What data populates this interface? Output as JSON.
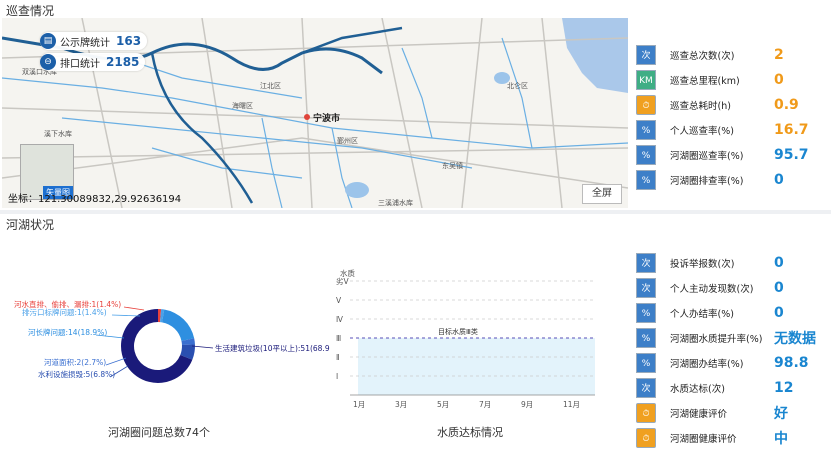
{
  "patrol": {
    "title": "巡查情况",
    "map": {
      "stat1_label": "公示牌统计",
      "stat1_value": "163",
      "stat2_label": "排口统计",
      "stat2_value": "2185",
      "city_label": "宁波市",
      "place_labels": [
        "双溪口水库",
        "溪下水库",
        "三溪浦水库",
        "海曙区",
        "江北区",
        "鄞州区",
        "北仑区",
        "东吴镇"
      ],
      "thumb_label": "矢量图",
      "coord_label": "坐标：121.30089832,29.92636194",
      "fullscreen_label": "全屏"
    },
    "stats": [
      {
        "icon": "次",
        "icon_name": "count-icon",
        "color": "blue",
        "label": "巡查总次数(次)",
        "value": "2",
        "vclass": "v-orange"
      },
      {
        "icon": "KM",
        "icon_name": "distance-icon",
        "color": "green",
        "label": "巡查总里程(km)",
        "value": "0",
        "vclass": "v-orange"
      },
      {
        "icon": "⏱",
        "icon_name": "clock-icon",
        "color": "orange",
        "label": "巡查总耗时(h)",
        "value": "0.9",
        "vclass": "v-orange"
      },
      {
        "icon": "%",
        "icon_name": "percent-icon",
        "color": "blue",
        "label": "个人巡查率(%)",
        "value": "16.7",
        "vclass": "v-orange"
      },
      {
        "icon": "%",
        "icon_name": "percent-icon",
        "color": "blue",
        "label": "河湖圈巡查率(%)",
        "value": "95.7",
        "vclass": "v-blue"
      },
      {
        "icon": "%",
        "icon_name": "percent-icon",
        "color": "blue",
        "label": "河湖圈排查率(%)",
        "value": "0",
        "vclass": "v-blue"
      }
    ]
  },
  "river": {
    "title": "河湖状况",
    "pie": {
      "caption": "河湖圈问题总数74个",
      "labels": [
        "河水直排、偷排、漏排:1(1.4%)",
        "排污口标牌问题:1(1.4%)",
        "河长牌问题:14(18.9%)",
        "河道面积:2(2.7%)",
        "水利设施损毁:5(6.8%)",
        "生活建筑垃圾(10平以上):51(68.9%)"
      ]
    },
    "wq": {
      "caption": "水质达标情况",
      "ylabel": "水质",
      "yticks": [
        "劣Ⅴ",
        "Ⅴ",
        "Ⅳ",
        "Ⅲ",
        "Ⅱ",
        "Ⅰ"
      ],
      "xticks": [
        "1月",
        "3月",
        "5月",
        "7月",
        "9月",
        "11月"
      ],
      "target_label": "目标水质Ⅲ类"
    },
    "stats": [
      {
        "icon": "次",
        "icon_name": "count-icon",
        "color": "blue",
        "label": "投诉举报数(次)",
        "value": "0",
        "vclass": "v-blue"
      },
      {
        "icon": "次",
        "icon_name": "count-icon",
        "color": "blue",
        "label": "个人主动发现数(次)",
        "value": "0",
        "vclass": "v-blue"
      },
      {
        "icon": "%",
        "icon_name": "percent-icon",
        "color": "blue",
        "label": "个人办结率(%)",
        "value": "0",
        "vclass": "v-blue"
      },
      {
        "icon": "%",
        "icon_name": "percent-icon",
        "color": "blue",
        "label": "河湖圈水质提升率(%)",
        "value": "无数据",
        "vclass": "v-blue"
      },
      {
        "icon": "%",
        "icon_name": "percent-icon",
        "color": "blue",
        "label": "河湖圈办结率(%)",
        "value": "98.8",
        "vclass": "v-blue"
      },
      {
        "icon": "次",
        "icon_name": "count-icon",
        "color": "blue",
        "label": "水质达标(次)",
        "value": "12",
        "vclass": "v-blue"
      },
      {
        "icon": "⏱",
        "icon_name": "clock-icon",
        "color": "orange",
        "label": "河湖健康评价",
        "value": "好",
        "vclass": "v-blue"
      },
      {
        "icon": "⏱",
        "icon_name": "clock-icon",
        "color": "orange",
        "label": "河湖圈健康评价",
        "value": "中",
        "vclass": "v-blue"
      }
    ]
  },
  "chart_data": [
    {
      "type": "pie",
      "title": "",
      "categories": [
        "河水直排、偷排、漏排",
        "排污口标牌问题",
        "河长牌问题",
        "河道面积",
        "水利设施损毁",
        "生活建筑垃圾(10平以上)"
      ],
      "values": [
        1,
        1,
        14,
        2,
        5,
        51
      ],
      "colors": [
        "#e8423c",
        "#4aa0e8",
        "#2e8fe0",
        "#3a6fd0",
        "#2a4fb0",
        "#1a1a7a"
      ]
    },
    {
      "type": "area",
      "title": "",
      "ylabel": "水质",
      "categories": [
        "劣Ⅴ",
        "Ⅴ",
        "Ⅳ",
        "Ⅲ",
        "Ⅱ",
        "Ⅰ"
      ],
      "x": [
        "1月",
        "3月",
        "5月",
        "7月",
        "9月",
        "11月"
      ],
      "target": "Ⅲ",
      "target_label": "目标水质Ⅲ类",
      "filled_to": "Ⅲ"
    }
  ]
}
